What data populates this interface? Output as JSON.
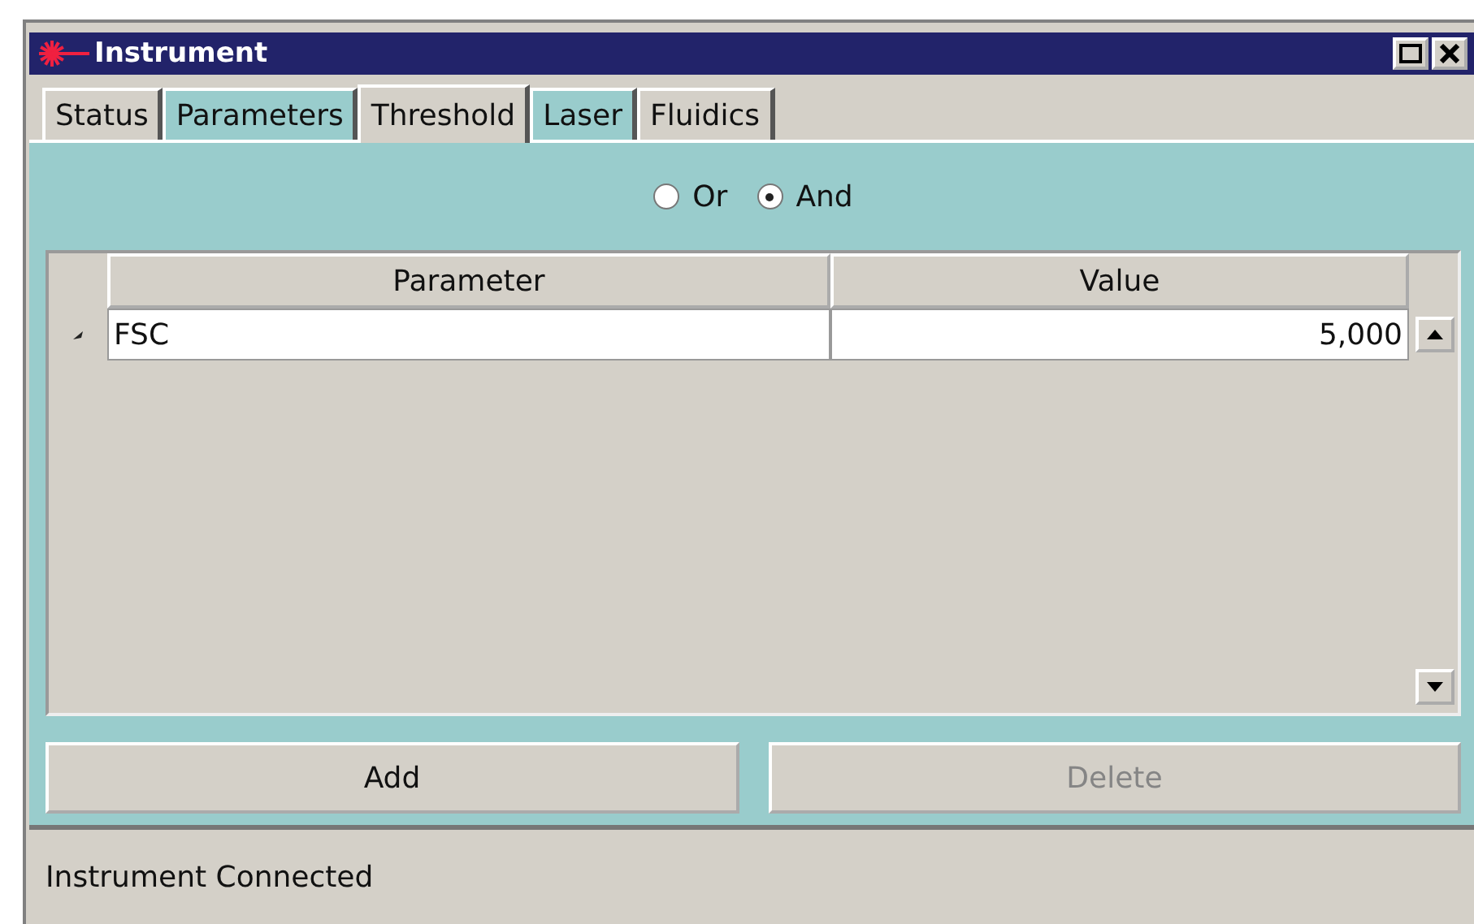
{
  "window": {
    "title": "Instrument"
  },
  "tabs": [
    {
      "label": "Status",
      "selected": false,
      "color": "#d4d0c8"
    },
    {
      "label": "Parameters",
      "selected": false,
      "color": "#99cccc"
    },
    {
      "label": "Threshold",
      "selected": true,
      "color": "#d4d0c8"
    },
    {
      "label": "Laser",
      "selected": false,
      "color": "#99cccc"
    },
    {
      "label": "Fluidics",
      "selected": false,
      "color": "#d4d0c8"
    }
  ],
  "logic": [
    {
      "label": "Or",
      "selected": false
    },
    {
      "label": "And",
      "selected": true
    }
  ],
  "table": {
    "columns": [
      "Parameter",
      "Value"
    ],
    "rows": [
      {
        "parameter": "FSC",
        "value": "5,000",
        "selected": true
      }
    ]
  },
  "buttons": [
    {
      "label": "Add",
      "disabled": false
    },
    {
      "label": "Delete",
      "disabled": true
    }
  ],
  "status_bar": "Instrument Connected"
}
